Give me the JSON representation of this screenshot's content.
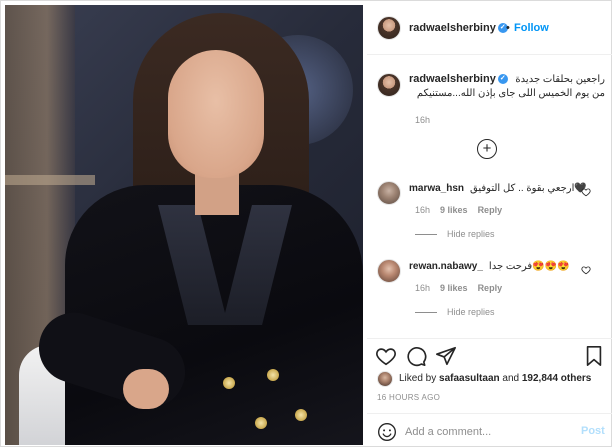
{
  "post": {
    "username": "radwaelsherbiny",
    "separator": "•",
    "follow_label": "Follow",
    "caption_line1": "راجعين بحلقات جديدة",
    "caption_line2": "من يوم الخميس اللى جاى بإذن الله...مستنيكم",
    "caption_time": "16h"
  },
  "comments": [
    {
      "username": "marwa_hsn",
      "text": "ارجعي بقوة .. كل التوفيق🖤",
      "time": "16h",
      "likes": "9 likes",
      "reply_label": "Reply",
      "hide_replies_label": "Hide replies"
    },
    {
      "username": "rewan.nabawy_",
      "text": "فرحت جدا😍😍😍",
      "time": "16h",
      "likes": "9 likes",
      "reply_label": "Reply",
      "hide_replies_label": "Hide replies"
    }
  ],
  "actions": {
    "liked_by_prefix": "Liked by ",
    "liked_by_user": "safaasultaan",
    "liked_by_middle": " and ",
    "liked_by_count": "192,844 others",
    "timestamp": "16 HOURS AGO"
  },
  "add_comment": {
    "placeholder": "Add a comment...",
    "post_label": "Post"
  },
  "colors": {
    "accent": "#0095f6",
    "verified": "#3897f0",
    "muted": "#8e8e8e",
    "post_disabled": "#b2dffc"
  },
  "icons": [
    "verified-icon",
    "heart-icon",
    "comment-icon",
    "share-icon",
    "bookmark-icon",
    "add-circle-icon",
    "smiley-icon"
  ]
}
